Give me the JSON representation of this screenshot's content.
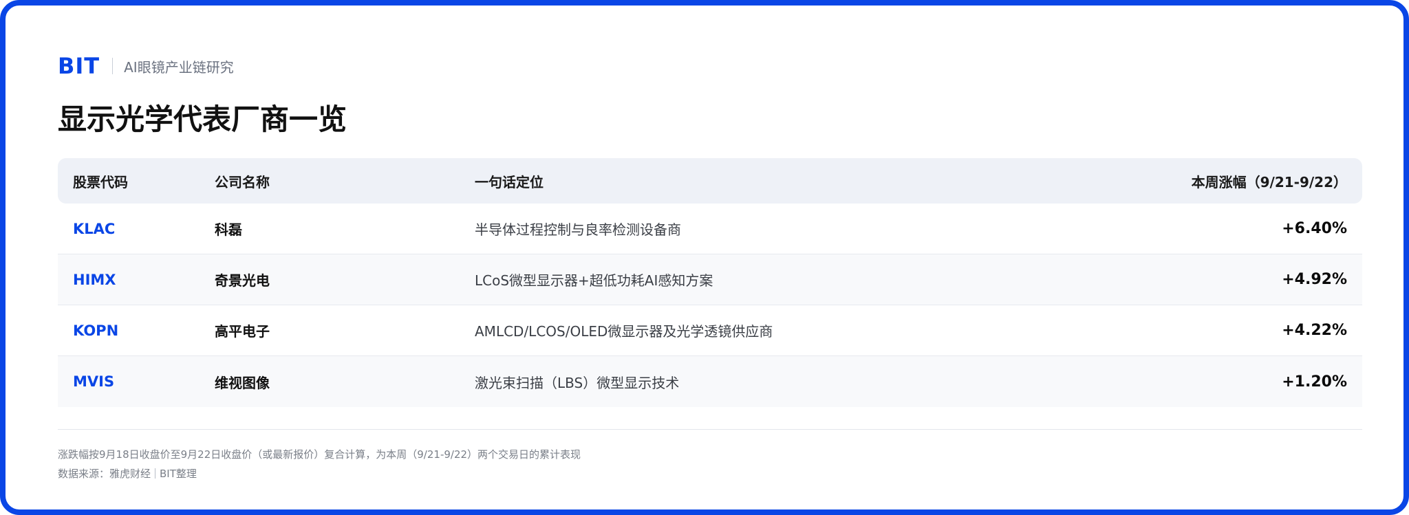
{
  "brand": {
    "logo": "BIT",
    "subtitle": "AI眼镜产业链研究"
  },
  "page_title": "显示光学代表厂商一览",
  "table": {
    "headers": {
      "ticker": "股票代码",
      "company": "公司名称",
      "positioning": "一句话定位",
      "weekly_change": "本周涨幅（9/21-9/22）"
    },
    "rows": [
      {
        "ticker": "KLAC",
        "company": "科磊",
        "positioning": "半导体过程控制与良率检测设备商",
        "change": "+6.40%"
      },
      {
        "ticker": "HIMX",
        "company": "奇景光电",
        "positioning": "LCoS微型显示器+超低功耗AI感知方案",
        "change": "+4.92%"
      },
      {
        "ticker": "KOPN",
        "company": "高平电子",
        "positioning": "AMLCD/LCOS/OLED微显示器及光学透镜供应商",
        "change": "+4.22%"
      },
      {
        "ticker": "MVIS",
        "company": "维视图像",
        "positioning": "激光束扫描（LBS）微型显示技术",
        "change": "+1.20%"
      }
    ]
  },
  "footnote": {
    "method": "涨跌幅按9月18日收盘价至9月22日收盘价（或最新报价）复合计算，为本周（9/21-9/22）两个交易日的累计表现",
    "source_label": "数据来源：雅虎财经",
    "source_org": "BIT整理"
  },
  "colors": {
    "accent": "#0a46e6",
    "header_bg": "#eef1f7",
    "alt_row_bg": "#f8f9fb"
  }
}
